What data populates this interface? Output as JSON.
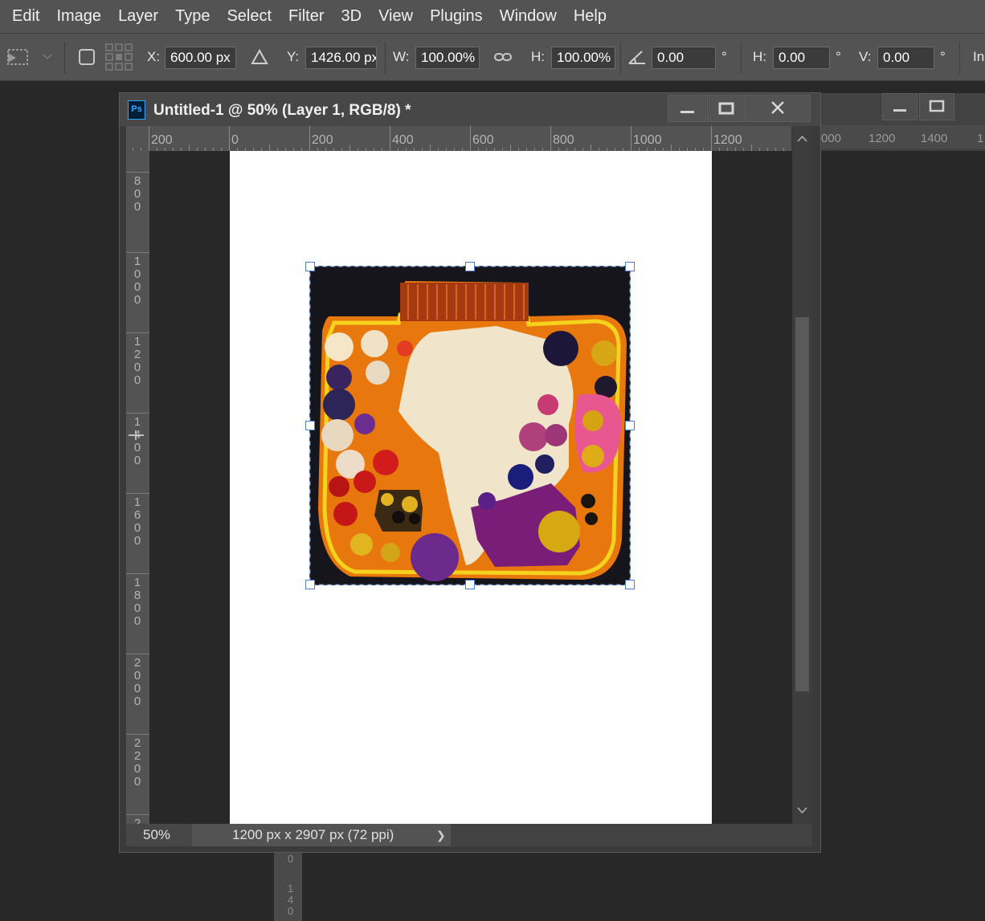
{
  "menu": [
    "Edit",
    "Image",
    "Layer",
    "Type",
    "Select",
    "Filter",
    "3D",
    "View",
    "Plugins",
    "Window",
    "Help"
  ],
  "options": {
    "x_label": "X:",
    "x_value": "600.00 px",
    "y_label": "Y:",
    "y_value": "1426.00 px",
    "w_label": "W:",
    "w_value": "100.00%",
    "h_label": "H:",
    "h_value": "100.00%",
    "rotate_value": "0.00",
    "degree": "°",
    "hskew_label": "H:",
    "hskew_value": "0.00",
    "vskew_label": "V:",
    "vskew_value": "0.00",
    "interp_label": "In"
  },
  "document": {
    "title": "Untitled-1 @ 50% (Layer 1, RGB/8) *",
    "app_icon": "Ps",
    "h_ruler_labels": [
      "200",
      "0",
      "200",
      "400",
      "600",
      "800",
      "1000",
      "1200"
    ],
    "v_ruler_labels": [
      "800",
      "1000",
      "1200",
      "1400",
      "1600",
      "1800",
      "2000",
      "2200",
      "2"
    ],
    "zoom": "50%",
    "doc_info": "1200 px x 2907 px (72 ppi)",
    "status_arrow": "❯"
  },
  "background_window": {
    "h_ruler_labels": [
      "000",
      "1200",
      "1400",
      "1"
    ],
    "v_ruler_labels": [
      "0",
      "1400"
    ]
  },
  "colors": {
    "ui_dark": "#282828",
    "ui_panel": "#535353",
    "transform_handle": "#4a7fd1",
    "canvas": "#ffffff"
  }
}
